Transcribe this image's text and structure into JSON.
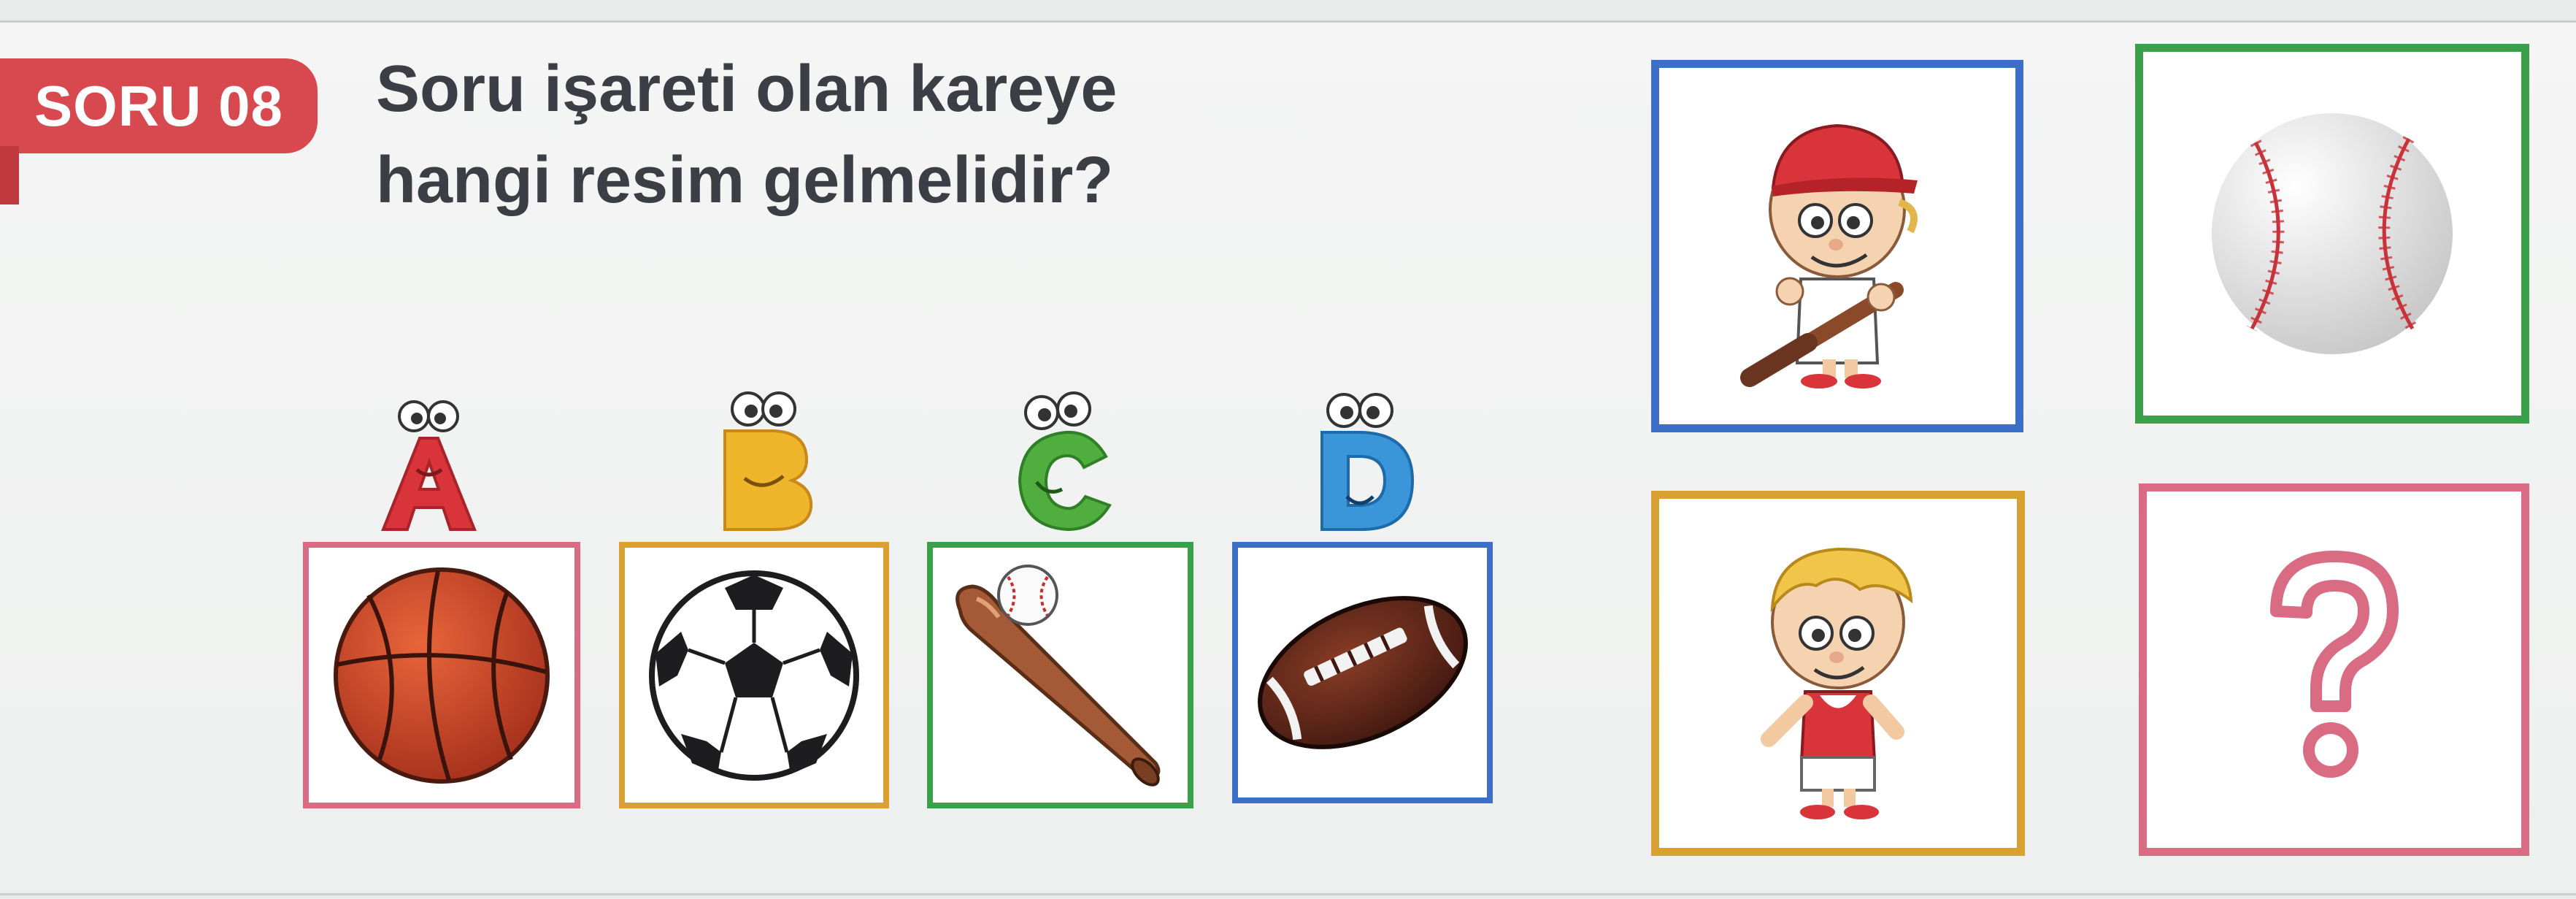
{
  "badge": {
    "label": "SORU 08"
  },
  "question": {
    "line1": "Soru işareti olan kareye",
    "line2": "hangi resim gelmelidir?"
  },
  "options": [
    {
      "letter": "A",
      "picture": "basketball-icon",
      "border": "#d96b82",
      "letter_color": "#d8343a"
    },
    {
      "letter": "B",
      "picture": "soccer-ball-icon",
      "border": "#d9a032",
      "letter_color": "#efb52b"
    },
    {
      "letter": "C",
      "picture": "baseball-bat-and-ball-icon",
      "border": "#3aa14a",
      "letter_color": "#4fae3d"
    },
    {
      "letter": "D",
      "picture": "american-football-icon",
      "border": "#3c6fc7",
      "letter_color": "#3a96d9"
    }
  ],
  "grid": [
    {
      "picture": "baseball-player-boy-icon",
      "border": "#3c6fc7"
    },
    {
      "picture": "baseball-icon",
      "border": "#3aa14a"
    },
    {
      "picture": "basketball-player-boy-icon",
      "border": "#d9a032"
    },
    {
      "picture": "question-mark",
      "label": "?",
      "border": "#d96b82",
      "color": "#d96b82"
    }
  ]
}
